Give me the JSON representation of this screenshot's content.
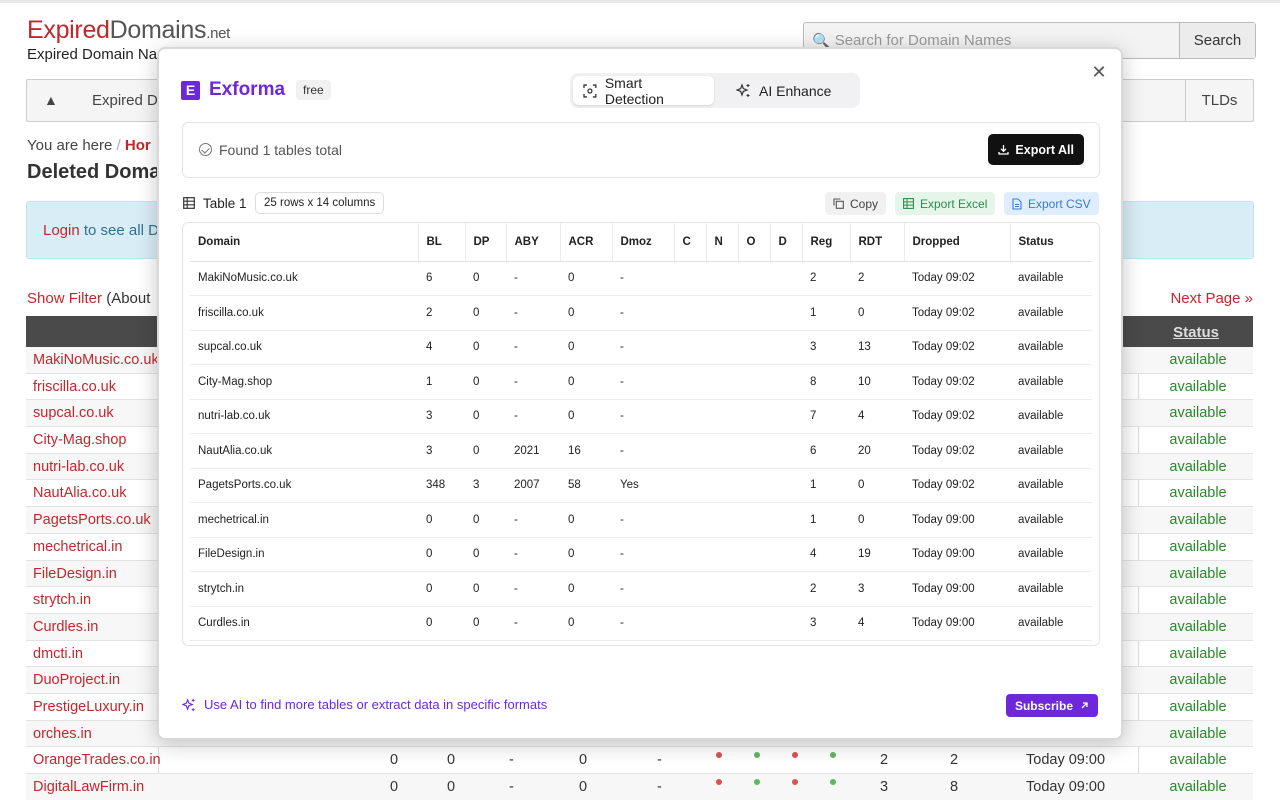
{
  "site": {
    "logo_expired": "Expired",
    "logo_domains": "Domains",
    "logo_tld": ".net",
    "tagline": "Expired Domain Na",
    "search_placeholder": "Search for Domain Names",
    "search_button": "Search",
    "nav_item": "Expired D",
    "nav_tlds": "TLDs",
    "breadcrumb_prefix": "You are here",
    "breadcrumb_home": "Hor",
    "page_heading": "Deleted Doma",
    "alert_login": "Login",
    "alert_text": " to see all D",
    "show_filter": "Show Filter",
    "filter_about": " (About",
    "next_page": "Next Page »",
    "status_header": "Status",
    "rows": [
      {
        "domain": "MakiNoMusic.co.uk",
        "status": "available"
      },
      {
        "domain": "friscilla.co.uk",
        "status": "available"
      },
      {
        "domain": "supcal.co.uk",
        "status": "available"
      },
      {
        "domain": "City-Mag.shop",
        "status": "available"
      },
      {
        "domain": "nutri-lab.co.uk",
        "status": "available"
      },
      {
        "domain": "NautAlia.co.uk",
        "status": "available"
      },
      {
        "domain": "PagetsPorts.co.uk",
        "status": "available"
      },
      {
        "domain": "mechetrical.in",
        "status": "available"
      },
      {
        "domain": "FileDesign.in",
        "status": "available"
      },
      {
        "domain": "strytch.in",
        "status": "available"
      },
      {
        "domain": "Curdles.in",
        "status": "available"
      },
      {
        "domain": "dmcti.in",
        "status": "available"
      },
      {
        "domain": "DuoProject.in",
        "status": "available"
      },
      {
        "domain": "PrestigeLuxury.in",
        "status": "available"
      },
      {
        "domain": "orches.in",
        "status": "available"
      },
      {
        "domain": "OrangeTrades.co.in",
        "status": "available",
        "bl": "0",
        "dp": "0",
        "aby": "-",
        "acr": "0",
        "dmoz": "-",
        "reg": "2",
        "rdt": "2",
        "dropped": "Today 09:00"
      },
      {
        "domain": "DigitalLawFirm.in",
        "status": "available",
        "bl": "0",
        "dp": "0",
        "aby": "-",
        "acr": "0",
        "dmoz": "-",
        "reg": "3",
        "rdt": "8",
        "dropped": "Today 09:00"
      }
    ]
  },
  "modal": {
    "brand_name": "Exforma",
    "brand_logo_letter": "E",
    "brand_badge": "free",
    "tab_smart": "Smart Detection",
    "tab_ai": "AI Enhance",
    "found_text": "Found 1 tables total",
    "export_all": "Export All",
    "table_title": "Table 1",
    "table_dims": "25 rows x 14 columns",
    "copy": "Copy",
    "export_excel": "Export Excel",
    "export_csv": "Export CSV",
    "columns": [
      "Domain",
      "BL",
      "DP",
      "ABY",
      "ACR",
      "Dmoz",
      "C",
      "N",
      "O",
      "D",
      "Reg",
      "RDT",
      "Dropped",
      "Status"
    ],
    "rows": [
      [
        "MakiNoMusic.co.uk",
        "6",
        "0",
        "-",
        "0",
        "-",
        "",
        "",
        "",
        "",
        "2",
        "2",
        "Today 09:02",
        "available"
      ],
      [
        "friscilla.co.uk",
        "2",
        "0",
        "-",
        "0",
        "-",
        "",
        "",
        "",
        "",
        "1",
        "0",
        "Today 09:02",
        "available"
      ],
      [
        "supcal.co.uk",
        "4",
        "0",
        "-",
        "0",
        "-",
        "",
        "",
        "",
        "",
        "3",
        "13",
        "Today 09:02",
        "available"
      ],
      [
        "City-Mag.shop",
        "1",
        "0",
        "-",
        "0",
        "-",
        "",
        "",
        "",
        "",
        "8",
        "10",
        "Today 09:02",
        "available"
      ],
      [
        "nutri-lab.co.uk",
        "3",
        "0",
        "-",
        "0",
        "-",
        "",
        "",
        "",
        "",
        "7",
        "4",
        "Today 09:02",
        "available"
      ],
      [
        "NautAlia.co.uk",
        "3",
        "0",
        "2021",
        "16",
        "-",
        "",
        "",
        "",
        "",
        "6",
        "20",
        "Today 09:02",
        "available"
      ],
      [
        "PagetsPorts.co.uk",
        "348",
        "3",
        "2007",
        "58",
        "Yes",
        "",
        "",
        "",
        "",
        "1",
        "0",
        "Today 09:02",
        "available"
      ],
      [
        "mechetrical.in",
        "0",
        "0",
        "-",
        "0",
        "-",
        "",
        "",
        "",
        "",
        "1",
        "0",
        "Today 09:00",
        "available"
      ],
      [
        "FileDesign.in",
        "0",
        "0",
        "-",
        "0",
        "-",
        "",
        "",
        "",
        "",
        "4",
        "19",
        "Today 09:00",
        "available"
      ],
      [
        "strytch.in",
        "0",
        "0",
        "-",
        "0",
        "-",
        "",
        "",
        "",
        "",
        "2",
        "3",
        "Today 09:00",
        "available"
      ],
      [
        "Curdles.in",
        "0",
        "0",
        "-",
        "0",
        "-",
        "",
        "",
        "",
        "",
        "3",
        "4",
        "Today 09:00",
        "available"
      ]
    ],
    "ai_prompt": "Use AI to find more tables or extract data in specific formats",
    "subscribe": "Subscribe"
  }
}
